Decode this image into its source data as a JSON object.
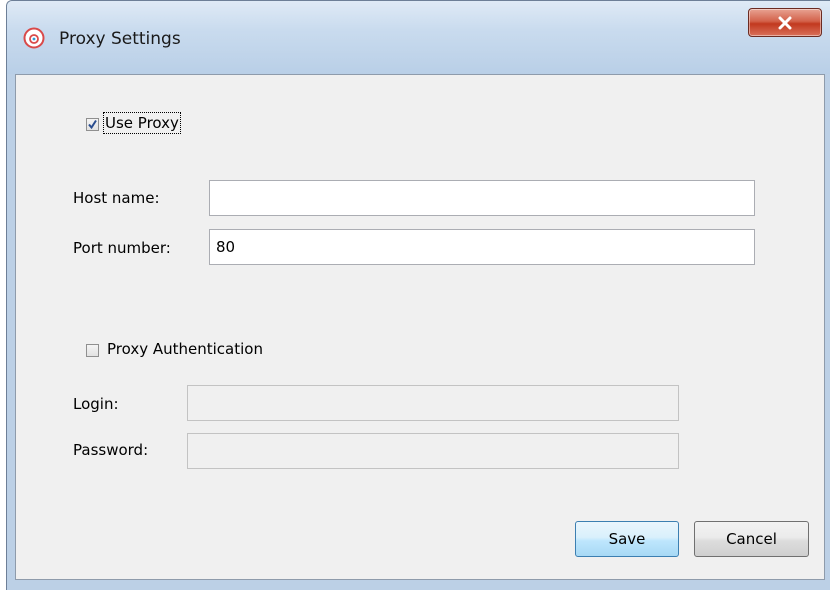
{
  "window": {
    "title": "Proxy Settings",
    "close_label": "x"
  },
  "use_proxy": {
    "label": "Use Proxy",
    "checked": true
  },
  "host": {
    "label": "Host name:",
    "value": ""
  },
  "port": {
    "label": "Port number:",
    "value": "80"
  },
  "proxy_auth": {
    "label": "Proxy Authentication",
    "checked": false
  },
  "login": {
    "label": "Login:",
    "value": ""
  },
  "password": {
    "label": "Password:",
    "value": ""
  },
  "buttons": {
    "save": "Save",
    "cancel": "Cancel"
  },
  "colors": {
    "titlebar": "#c9dbee",
    "close": "#c2391f",
    "panel": "#f0f0f0",
    "default_button": "#bee6fd",
    "app_icon": "#d94a4a"
  },
  "icons": {
    "app": "cloud-icon",
    "close": "close-icon",
    "check": "checkmark-icon"
  }
}
